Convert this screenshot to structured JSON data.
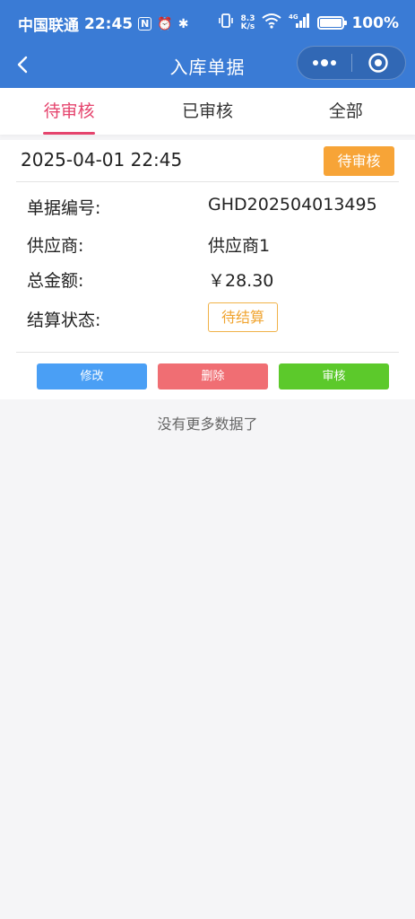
{
  "status_bar": {
    "carrier": "中国联通",
    "time": "22:45",
    "icon_nfc": "N",
    "icon_alarm": "⏰",
    "icon_bluetooth": "✱",
    "speed_value": "8.3",
    "speed_unit": "K/s",
    "battery": "100%"
  },
  "nav": {
    "title": "入库单据"
  },
  "tabs": [
    {
      "label": "待审核"
    },
    {
      "label": "已审核"
    },
    {
      "label": "全部"
    }
  ],
  "active_tab_color": "#e5446d",
  "order": {
    "datetime": "2025-04-01 22:45",
    "status": "待审核",
    "fields": [
      {
        "label": "单据编号:",
        "value": "GHD202504013495"
      },
      {
        "label": "供应商:",
        "value": "供应商1"
      },
      {
        "label": "总金额:",
        "value": "￥28.30"
      },
      {
        "label": "结算状态:",
        "value": "待结算"
      }
    ],
    "actions": [
      {
        "label": "修改",
        "color": "#4a9ff5"
      },
      {
        "label": "删除",
        "color": "#f06e73"
      },
      {
        "label": "审核",
        "color": "#5cc92b"
      }
    ]
  },
  "empty_tip": "没有更多数据了",
  "colors": {
    "header": "#3a7bd5",
    "status_badge": "#f7a437",
    "settle_tag": "#f0a430"
  }
}
